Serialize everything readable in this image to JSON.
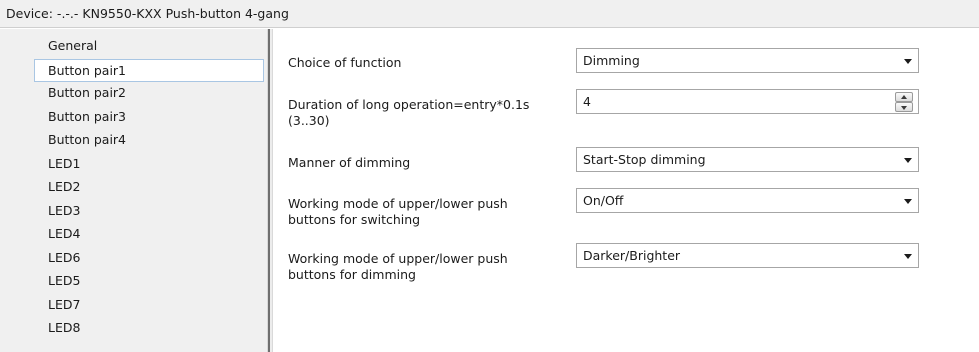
{
  "header": {
    "device_label": "Device: -.-.-",
    "device_name": "KN9550-KXX Push-button 4-gang"
  },
  "sidebar": {
    "items": [
      {
        "label": "General"
      },
      {
        "label": "Button pair1",
        "selected": true
      },
      {
        "label": "Button pair2"
      },
      {
        "label": "Button pair3"
      },
      {
        "label": "Button pair4"
      },
      {
        "label": "LED1"
      },
      {
        "label": "LED2"
      },
      {
        "label": "LED3"
      },
      {
        "label": "LED4"
      },
      {
        "label": "LED6"
      },
      {
        "label": "LED5"
      },
      {
        "label": "LED7"
      },
      {
        "label": "LED8"
      }
    ]
  },
  "params": {
    "function": {
      "label": "Choice of function",
      "value": "Dimming"
    },
    "duration": {
      "label": "Duration of long operation=entry*0.1s\n(3..30)",
      "value": "4"
    },
    "dimming_manner": {
      "label": "Manner of dimming",
      "value": "Start-Stop dimming"
    },
    "switch_mode": {
      "label": "Working mode of upper/lower push\nbuttons for switching",
      "value": "On/Off"
    },
    "dim_mode": {
      "label": "Working mode of upper/lower push\nbuttons for dimming",
      "value": "Darker/Brighter"
    }
  },
  "icons": {
    "dropdown": "chevron-down-icon",
    "spin_up": "arrow-up-icon",
    "spin_down": "arrow-down-icon"
  },
  "colors": {
    "sidebar_bg": "#f0f0f0",
    "selection_border": "#a9c6e3",
    "splitter": "#6f6f6f"
  }
}
